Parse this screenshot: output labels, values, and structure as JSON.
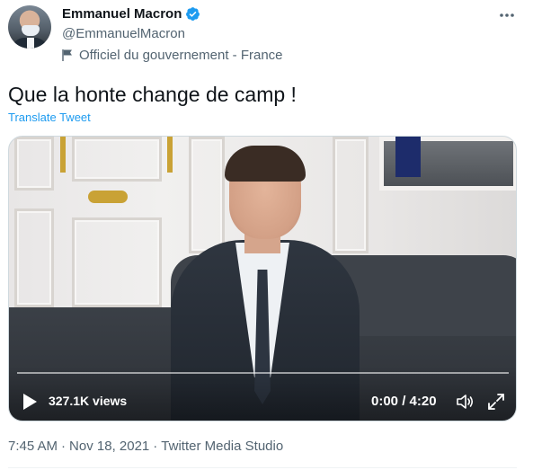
{
  "author": {
    "display_name": "Emmanuel Macron",
    "handle": "@EmmanuelMacron",
    "affiliation": "Officiel du gouvernement - France",
    "verified": true
  },
  "icons": {
    "avatar": "avatar-photo",
    "verified": "verified-badge-icon",
    "affiliation": "flag-icon",
    "more": "more-dots-icon",
    "play": "play-icon",
    "volume": "volume-icon",
    "fullscreen": "fullscreen-icon"
  },
  "tweet": {
    "text": "Que la honte change de camp !",
    "translate_label": "Translate Tweet"
  },
  "video": {
    "views": "327.1K views",
    "time": "0:00 / 4:20",
    "progress": 0.0
  },
  "meta": {
    "time": "7:45 AM",
    "separator": "·",
    "date": "Nov 18, 2021",
    "source": "Twitter Media Studio"
  },
  "colors": {
    "accent": "#1d9bf0",
    "verified": "#1d9bf0",
    "secondary_text": "#536471",
    "primary_text": "#0f1419"
  }
}
